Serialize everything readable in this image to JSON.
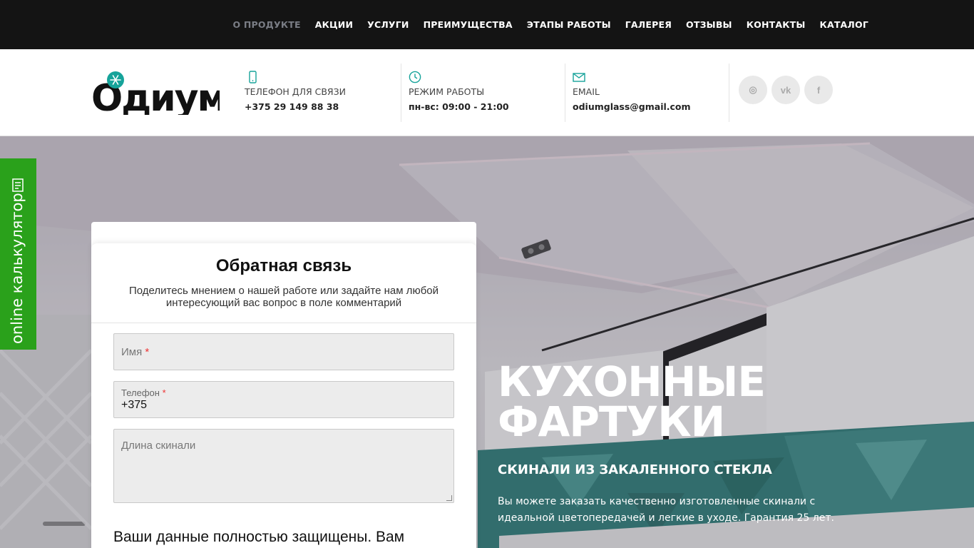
{
  "nav": {
    "items": [
      {
        "label": "О ПРОДУКТЕ"
      },
      {
        "label": "АКЦИИ"
      },
      {
        "label": "УСЛУГИ"
      },
      {
        "label": "ПРЕИМУЩЕСТВА"
      },
      {
        "label": "ЭТАПЫ РАБОТЫ"
      },
      {
        "label": "ГАЛЕРЕЯ"
      },
      {
        "label": "ОТЗЫВЫ"
      },
      {
        "label": "КОНТАКТЫ"
      },
      {
        "label": "КАТАЛОГ"
      }
    ]
  },
  "header": {
    "logo_text": "Одиум",
    "phone": {
      "label": "ТЕЛЕФОН ДЛЯ СВЯЗИ",
      "value": "+375 29 149 88 38",
      "icon": "phone-icon"
    },
    "hours": {
      "label": "РЕЖИМ РАБОТЫ",
      "value": "пн-вс: 09:00 - 21:00",
      "icon": "clock-icon"
    },
    "email": {
      "label": "EMAIL",
      "value": "odiumglass@gmail.com",
      "icon": "mail-icon"
    },
    "social": [
      {
        "name": "instagram-icon",
        "glyph": "◎"
      },
      {
        "name": "vk-icon",
        "glyph": "vk"
      },
      {
        "name": "facebook-icon",
        "glyph": "f"
      }
    ]
  },
  "calculator": {
    "label": "online калькулятор"
  },
  "form": {
    "title": "Обратная связь",
    "subtitle": "Поделитесь мнением о нашей работе или задайте нам любой интересующий вас вопрос в поле комментарий",
    "name_placeholder": "Имя",
    "phone_label": "Телефон",
    "phone_value": "+375",
    "length_placeholder": "Длина скинали",
    "required_mark": "*",
    "notice": "Ваши данные полностью защищены. Вам"
  },
  "hero": {
    "title_line1": "КУХОННЫЕ",
    "title_line2": "ФАРТУКИ",
    "subtitle": "СКИНАЛИ ИЗ ЗАКАЛЕННОГО СТЕКЛА",
    "description": "Вы можете заказать качественно изготовленные  скинали с идеальной цветопередачей и легкие в уходе. Гарантия 25 лет."
  },
  "colors": {
    "nav_bg": "#141414",
    "accent_teal": "#16a39a",
    "calc_green": "#2aa11b"
  }
}
